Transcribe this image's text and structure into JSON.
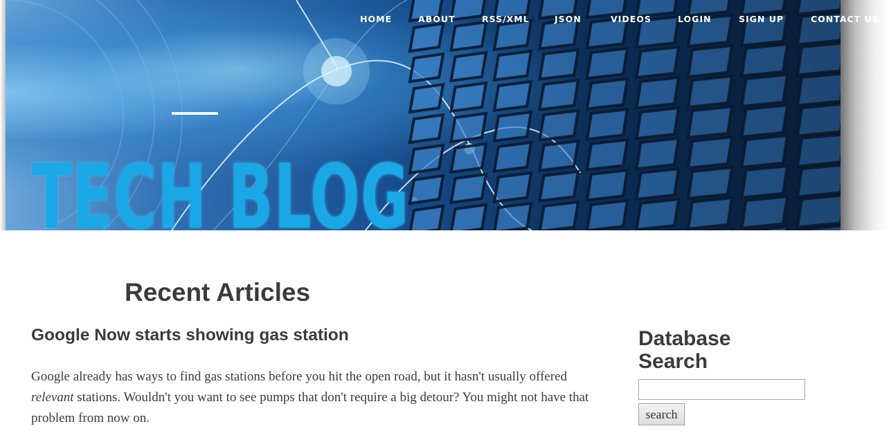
{
  "brand": {
    "logo_text": "TECH BLOG",
    "accent": "#1aa7e6"
  },
  "nav": {
    "items": [
      {
        "label": "HOME"
      },
      {
        "label": "ABOUT"
      },
      {
        "label": "RSS/XML"
      },
      {
        "label": "JSON"
      },
      {
        "label": "VIDEOS"
      },
      {
        "label": "LOGIN"
      },
      {
        "label": "SIGN UP"
      },
      {
        "label": "CONTACT US"
      }
    ]
  },
  "main": {
    "section_title": "Recent Articles",
    "article": {
      "title": "Google Now starts showing gas station",
      "body_before": "Google already has ways to find gas stations before you hit the open road, but it hasn't usually offered ",
      "body_em": "relevant",
      "body_after": " stations. Wouldn't you want to see pumps that don't require a big detour? You might not have that problem from now on."
    }
  },
  "sidebar": {
    "title": "Database Search",
    "search": {
      "value": "",
      "button_label": "search"
    }
  },
  "colors": {
    "text": "#3b3b3b",
    "nav_text": "#ffffff"
  }
}
